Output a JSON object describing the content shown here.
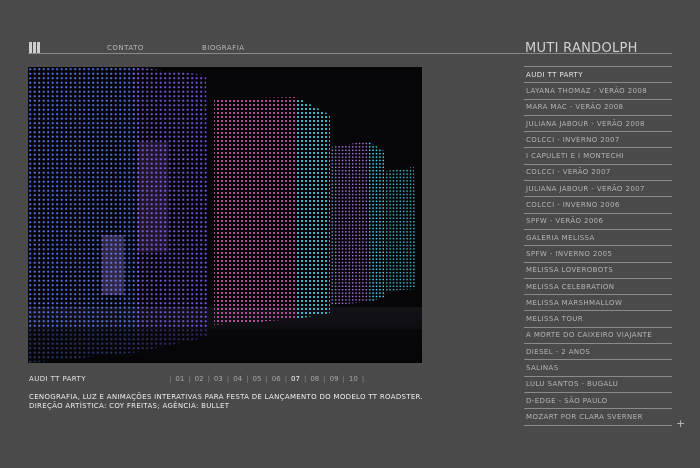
{
  "header": {
    "logo_icon": "bars-logo-icon",
    "nav": [
      "CONTATO",
      "BIOGRAFIA"
    ],
    "site_title": "MUTI RANDOLPH"
  },
  "project": {
    "title": "AUDI TT PARTY",
    "pages": [
      "01",
      "02",
      "03",
      "04",
      "05",
      "06",
      "07",
      "08",
      "09",
      "10"
    ],
    "current_page": "07",
    "description": [
      "CENOGRAFIA, LUZ E ANIMAÇÕES INTERATIVAS PARA FESTA DE LANÇAMENTO DO MODELO TT ROADSTER.",
      "DIREÇÃO ARTÍSTICA: COY FREITAS; AGÊNCIA: BULLET"
    ]
  },
  "sidebar": {
    "items": [
      "AUDI TT PARTY",
      "LAYANA THOMAZ - VERÃO 2008",
      "MARA MAC - VERÃO 2008",
      "JULIANA JABOUR - VERÃO 2008",
      "COLCCI - INVERNO 2007",
      "I CAPULETI E I MONTECHI",
      "COLCCI - VERÃO 2007",
      "JULIANA JABOUR - VERÃO 2007",
      "COLCCI - INVERNO 2006",
      "SPFW - VERÃO 2006",
      "GALERIA MELISSA",
      "SPFW - INVERNO 2005",
      "MELISSA LOVEROBOTS",
      "MELISSA CELEBRATION",
      "MELISSA MARSHMALLOW",
      "MELISSA TOUR",
      "A MORTE DO CAIXEIRO VIAJANTE",
      "DIESEL - 2 ANOS",
      "SALINAS",
      "LULU SANTOS - BUGALU",
      "D-EDGE - SÃO PAULO",
      "MOZART POR CLARA SVERNER"
    ],
    "more_icon": "plus-icon",
    "more_label": "+"
  },
  "colors": {
    "background": "#4a4a4a",
    "rule": "#8a8a8a",
    "text": "#d0d0d0",
    "led_blue": "#4f6dff",
    "led_cyan": "#4fe6ff",
    "led_pink": "#ff5fd6"
  }
}
